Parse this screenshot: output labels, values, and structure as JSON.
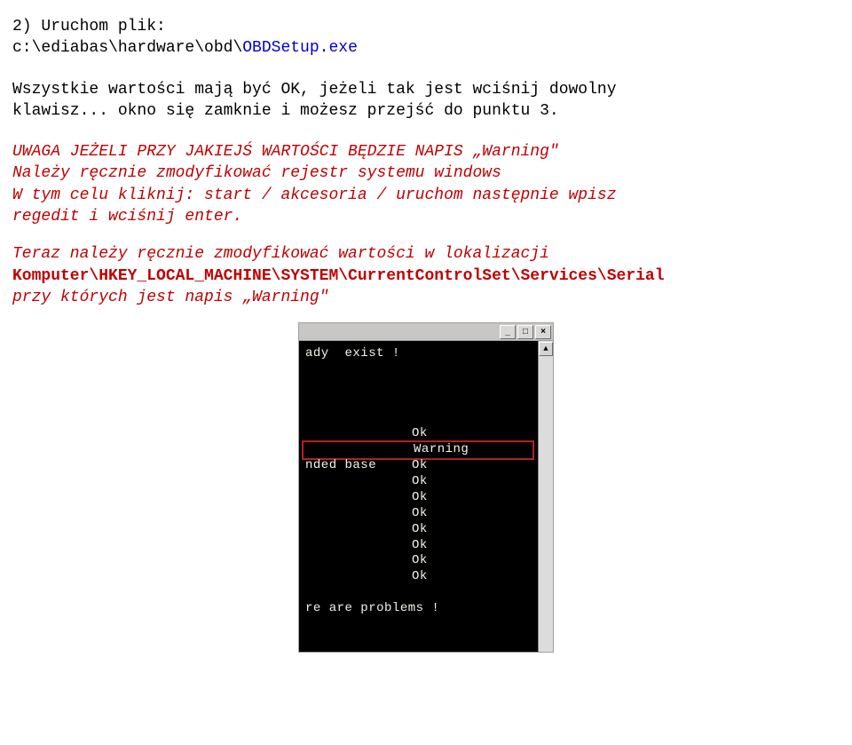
{
  "section_number": "2) ",
  "run_file_label": "Uruchom plik:",
  "run_file_path_prefix": "c:\\ediabas\\hardware\\obd\\",
  "run_file_exe": "OBDSetup.exe",
  "para1_line1": "Wszystkie wartości mają być OK, jeżeli tak jest wciśnij dowolny",
  "para1_line2": "klawisz... okno się zamknie i możesz przejść do punktu 3.",
  "warn_line1": "UWAGA JEŻELI PRZY JAKIEJŚ WARTOŚCI BĘDZIE NAPIS „Warning\"",
  "warn_line2": "Należy ręcznie zmodyfikować rejestr systemu windows",
  "warn_line3": "W tym celu kliknij: start / akcesoria / uruchom następnie wpisz",
  "warn_line4": "regedit i wciśnij enter.",
  "para2_line1": "Teraz należy ręcznie zmodyfikować wartości w lokalizacji",
  "reg_path": "Komputer\\HKEY_LOCAL_MACHINE\\SYSTEM\\CurrentControlSet\\Services\\Serial",
  "para2_line3": "przy których jest napis „Warning\"",
  "win_btn_min": "_",
  "win_btn_max": "□",
  "win_btn_close": "×",
  "scroll_up": "▲",
  "scroll_down": "▼",
  "terminal": {
    "exist_line": "ady  exist !",
    "rows_before": [
      {
        "left": "",
        "right": "Ok"
      }
    ],
    "highlight_row": {
      "left": "",
      "right": "Warning"
    },
    "rows_after": [
      {
        "left": "nded base",
        "right": "Ok"
      },
      {
        "left": "",
        "right": "Ok"
      },
      {
        "left": "",
        "right": "Ok"
      },
      {
        "left": "",
        "right": "Ok"
      },
      {
        "left": "",
        "right": "Ok"
      },
      {
        "left": "",
        "right": "Ok"
      },
      {
        "left": "",
        "right": "Ok"
      },
      {
        "left": "",
        "right": "Ok"
      }
    ],
    "problems_line": "re are problems !"
  }
}
